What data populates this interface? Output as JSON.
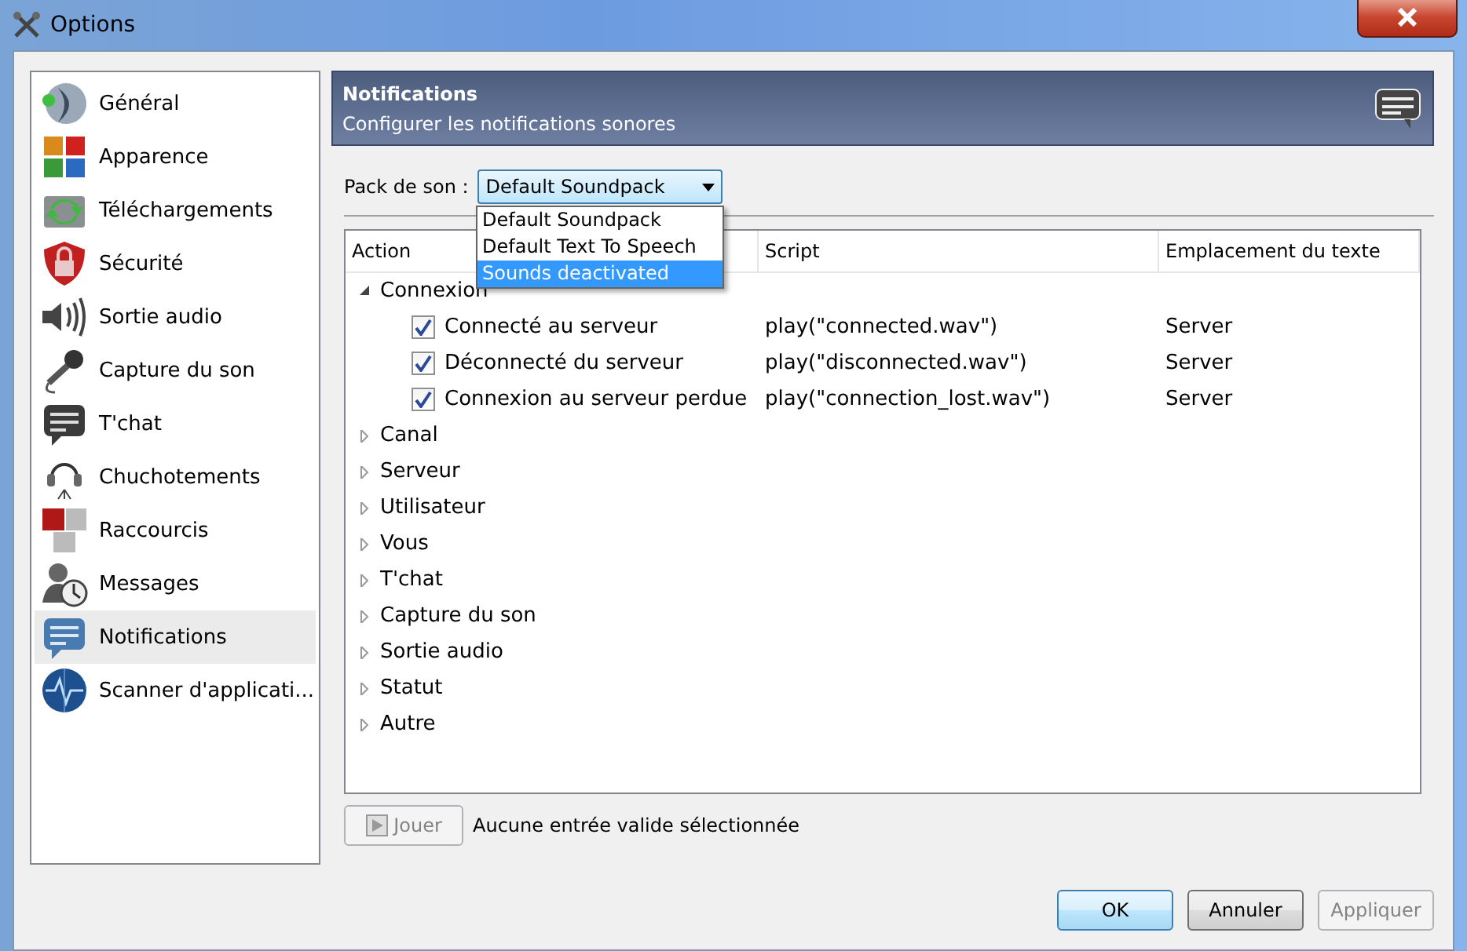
{
  "window": {
    "title": "Options"
  },
  "sidebar": {
    "items": [
      {
        "label": "Général",
        "selected": false
      },
      {
        "label": "Apparence",
        "selected": false
      },
      {
        "label": "Téléchargements",
        "selected": false
      },
      {
        "label": "Sécurité",
        "selected": false
      },
      {
        "label": "Sortie audio",
        "selected": false
      },
      {
        "label": "Capture du son",
        "selected": false
      },
      {
        "label": "T'chat",
        "selected": false
      },
      {
        "label": "Chuchotements",
        "selected": false
      },
      {
        "label": "Raccourcis",
        "selected": false
      },
      {
        "label": "Messages",
        "selected": false
      },
      {
        "label": "Notifications",
        "selected": true
      },
      {
        "label": "Scanner d'applicati...",
        "selected": false
      }
    ]
  },
  "header": {
    "title": "Notifications",
    "subtitle": "Configurer les notifications sonores"
  },
  "soundpack": {
    "label": "Pack de son :",
    "value": "Default Soundpack",
    "options": [
      {
        "label": "Default Soundpack",
        "highlighted": false
      },
      {
        "label": "Default Text To Speech",
        "highlighted": false
      },
      {
        "label": "Sounds deactivated",
        "highlighted": true
      }
    ]
  },
  "table": {
    "columns": [
      "Action",
      "Script",
      "Emplacement du texte"
    ],
    "groups": [
      {
        "label": "Connexion",
        "expanded": true,
        "children": [
          {
            "action": "Connecté au serveur",
            "checked": true,
            "script": "play(\"connected.wav\")",
            "location": "Server"
          },
          {
            "action": "Déconnecté du serveur",
            "checked": true,
            "script": "play(\"disconnected.wav\")",
            "location": "Server"
          },
          {
            "action": "Connexion au serveur perdue",
            "checked": true,
            "script": "play(\"connection_lost.wav\")",
            "location": "Server"
          }
        ]
      },
      {
        "label": "Canal",
        "expanded": false
      },
      {
        "label": "Serveur",
        "expanded": false
      },
      {
        "label": "Utilisateur",
        "expanded": false
      },
      {
        "label": "Vous",
        "expanded": false
      },
      {
        "label": "T'chat",
        "expanded": false
      },
      {
        "label": "Capture du son",
        "expanded": false
      },
      {
        "label": "Sortie audio",
        "expanded": false
      },
      {
        "label": "Statut",
        "expanded": false
      },
      {
        "label": "Autre",
        "expanded": false
      }
    ]
  },
  "play_button": {
    "label": "Jouer",
    "disabled": true
  },
  "status": "Aucune entrée valide sélectionnée",
  "buttons": [
    {
      "label": "OK",
      "disabled": false
    },
    {
      "label": "Annuler",
      "disabled": false
    },
    {
      "label": "Appliquer",
      "disabled": true
    }
  ]
}
